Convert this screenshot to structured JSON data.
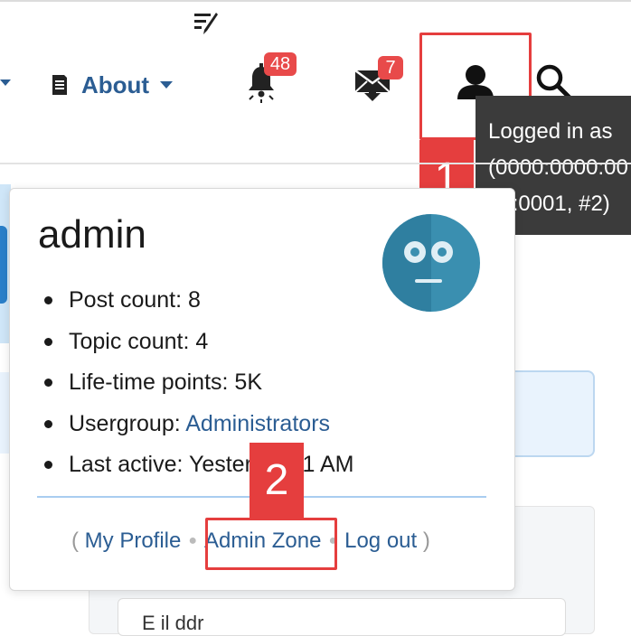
{
  "nav": {
    "about_label": "About",
    "notifications_count": "48",
    "messages_count": "7"
  },
  "tooltip": {
    "lines": [
      "Logged in as",
      "(0000:0000:00",
      "00:0001, #2)"
    ]
  },
  "profile_card": {
    "username": "admin",
    "stats": {
      "post_count": "Post count: 8",
      "topic_count": "Topic count: 4",
      "lifetime_points": "Life-time points: 5K",
      "usergroup_label": "Usergroup: ",
      "usergroup_value": "Administrators",
      "last_active": "Last active: Yester   12:31 AM"
    },
    "links": {
      "open_paren": "(",
      "my_profile": "My Profile",
      "admin_zone": "Admin Zone",
      "log_out": "Log out",
      "close_paren": ")"
    }
  },
  "annotations": {
    "marker_1": "1",
    "marker_2": "2"
  },
  "background": {
    "lower_text": "E    il   ddr"
  },
  "colors": {
    "link": "#2b5d93",
    "badge": "#e84a4a",
    "highlight": "#e53e3e",
    "tooltip_bg": "#3b3b3b",
    "avatar": "#3a8fb0"
  },
  "icons": {
    "logo": "feather-lines-logo-icon",
    "about": "document-icon",
    "notifications": "bell-icon",
    "messages": "envelope-download-icon",
    "user": "user-icon",
    "search": "search-icon"
  }
}
